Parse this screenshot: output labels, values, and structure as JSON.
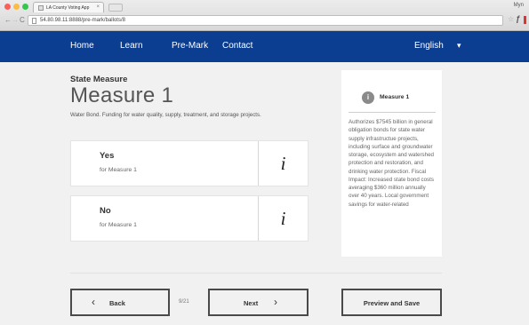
{
  "browser": {
    "tab_title": "LA County Voting App",
    "tab_close": "×",
    "url": "54.80.98.11:8888/pre-mark/ballots/8",
    "profile": "Myn",
    "back_glyph": "←",
    "forward_glyph": "→",
    "reload_glyph": "C",
    "star_glyph": "☆",
    "ext_glyph": "ƒ"
  },
  "nav": {
    "items": [
      "Home",
      "Learn",
      "Pre-Mark",
      "Contact"
    ],
    "language": "English",
    "language_caret": "▾"
  },
  "measure": {
    "eyebrow": "State Measure",
    "title": "Measure 1",
    "description": "Water Bond. Funding for water quality, supply, treatment, and storage projects."
  },
  "choices": [
    {
      "label": "Yes",
      "sub": "for Measure 1",
      "info": "i"
    },
    {
      "label": "No",
      "sub": "for Measure 1",
      "info": "i"
    }
  ],
  "info_card": {
    "icon": "i",
    "title": "Measure 1",
    "body": "Authorizes $7545 billion in general obligation bonds for state water supply infrastructue projects, including surface and groundwater storage, ecosystem and watershed protection and restoration, and drinking water protection. Fiscal Impact: Increased state bond costs averaging $360 million annually over 40 years. Local government savings for water-related"
  },
  "footer": {
    "back_label": "Back",
    "back_chevron": "‹",
    "page_count": "9/21",
    "next_label": "Next",
    "next_chevron": "›",
    "preview_label": "Preview and Save"
  },
  "colors": {
    "nav_bg": "#0b3d91",
    "page_bg": "#f1f1f1"
  }
}
